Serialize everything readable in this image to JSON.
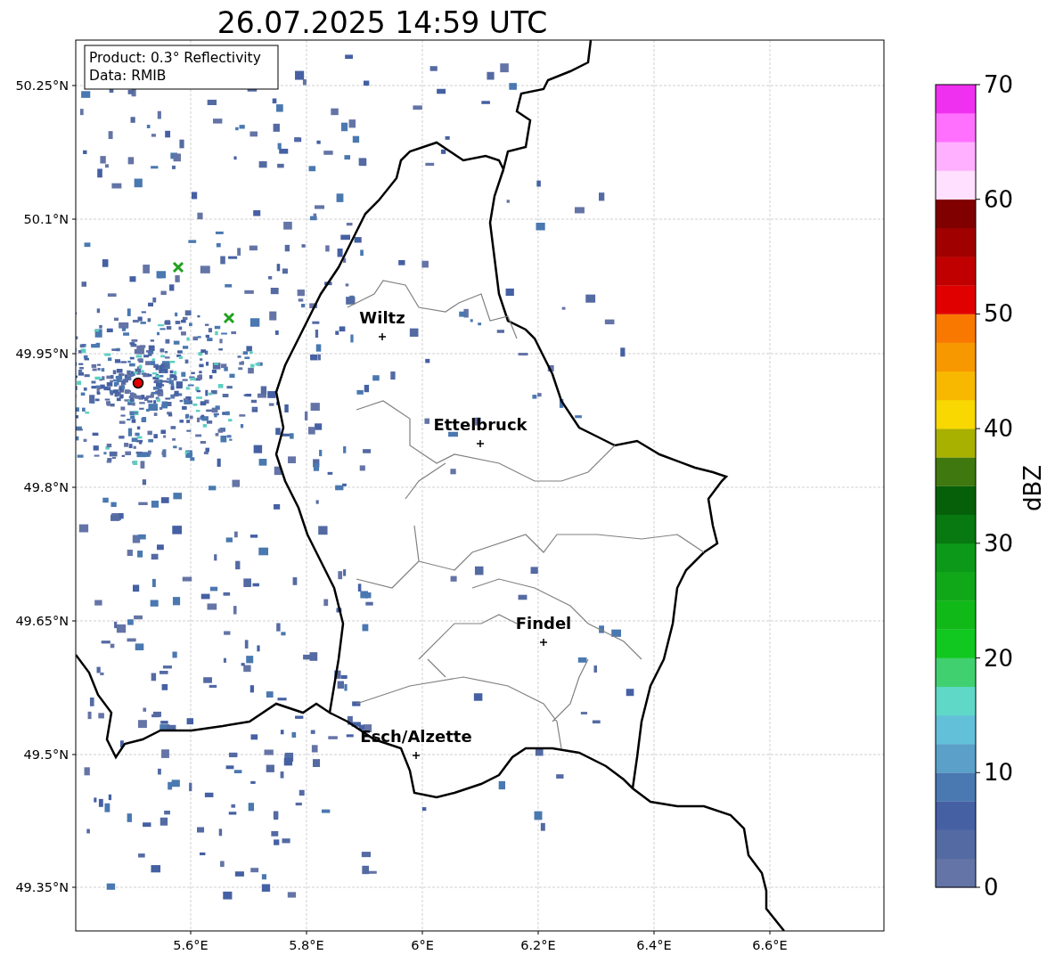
{
  "title": "26.07.2025 14:59 UTC",
  "legend": {
    "lines": [
      "Product: 0.3° Reflectivity",
      "Data: RMIB"
    ]
  },
  "map": {
    "x_ticks": [
      "5.6°E",
      "5.8°E",
      "6°E",
      "6.2°E",
      "6.4°E",
      "6.6°E"
    ],
    "y_ticks": [
      "50.25°N",
      "50.1°N",
      "49.95°N",
      "49.8°N",
      "49.65°N",
      "49.5°N",
      "49.35°N"
    ],
    "cities": [
      {
        "name": "Wiltz"
      },
      {
        "name": "Ettelbruck"
      },
      {
        "name": "Findel"
      },
      {
        "name": "Esch/Alzette"
      }
    ]
  },
  "colorbar": {
    "label": "dBZ",
    "ticks": [
      "70",
      "60",
      "50",
      "40",
      "30",
      "20",
      "10",
      "0"
    ],
    "bands": [
      {
        "color": "#6474a6"
      },
      {
        "color": "#546aa3"
      },
      {
        "color": "#4560a3"
      },
      {
        "color": "#4a78b0"
      },
      {
        "color": "#5aa0c8"
      },
      {
        "color": "#62c0d8"
      },
      {
        "color": "#60d8c8"
      },
      {
        "color": "#40d070"
      },
      {
        "color": "#10c820"
      },
      {
        "color": "#10b818"
      },
      {
        "color": "#10a818"
      },
      {
        "color": "#0c9818"
      },
      {
        "color": "#087810"
      },
      {
        "color": "#06600a"
      },
      {
        "color": "#407810"
      },
      {
        "color": "#a8b000"
      },
      {
        "color": "#f8d800"
      },
      {
        "color": "#f8b800"
      },
      {
        "color": "#f89800"
      },
      {
        "color": "#f87800"
      },
      {
        "color": "#e00000"
      },
      {
        "color": "#c00000"
      },
      {
        "color": "#a00000"
      },
      {
        "color": "#800000"
      },
      {
        "color": "#ffe0ff"
      },
      {
        "color": "#ffb0ff"
      },
      {
        "color": "#ff70ff"
      },
      {
        "color": "#f030f0"
      }
    ]
  }
}
